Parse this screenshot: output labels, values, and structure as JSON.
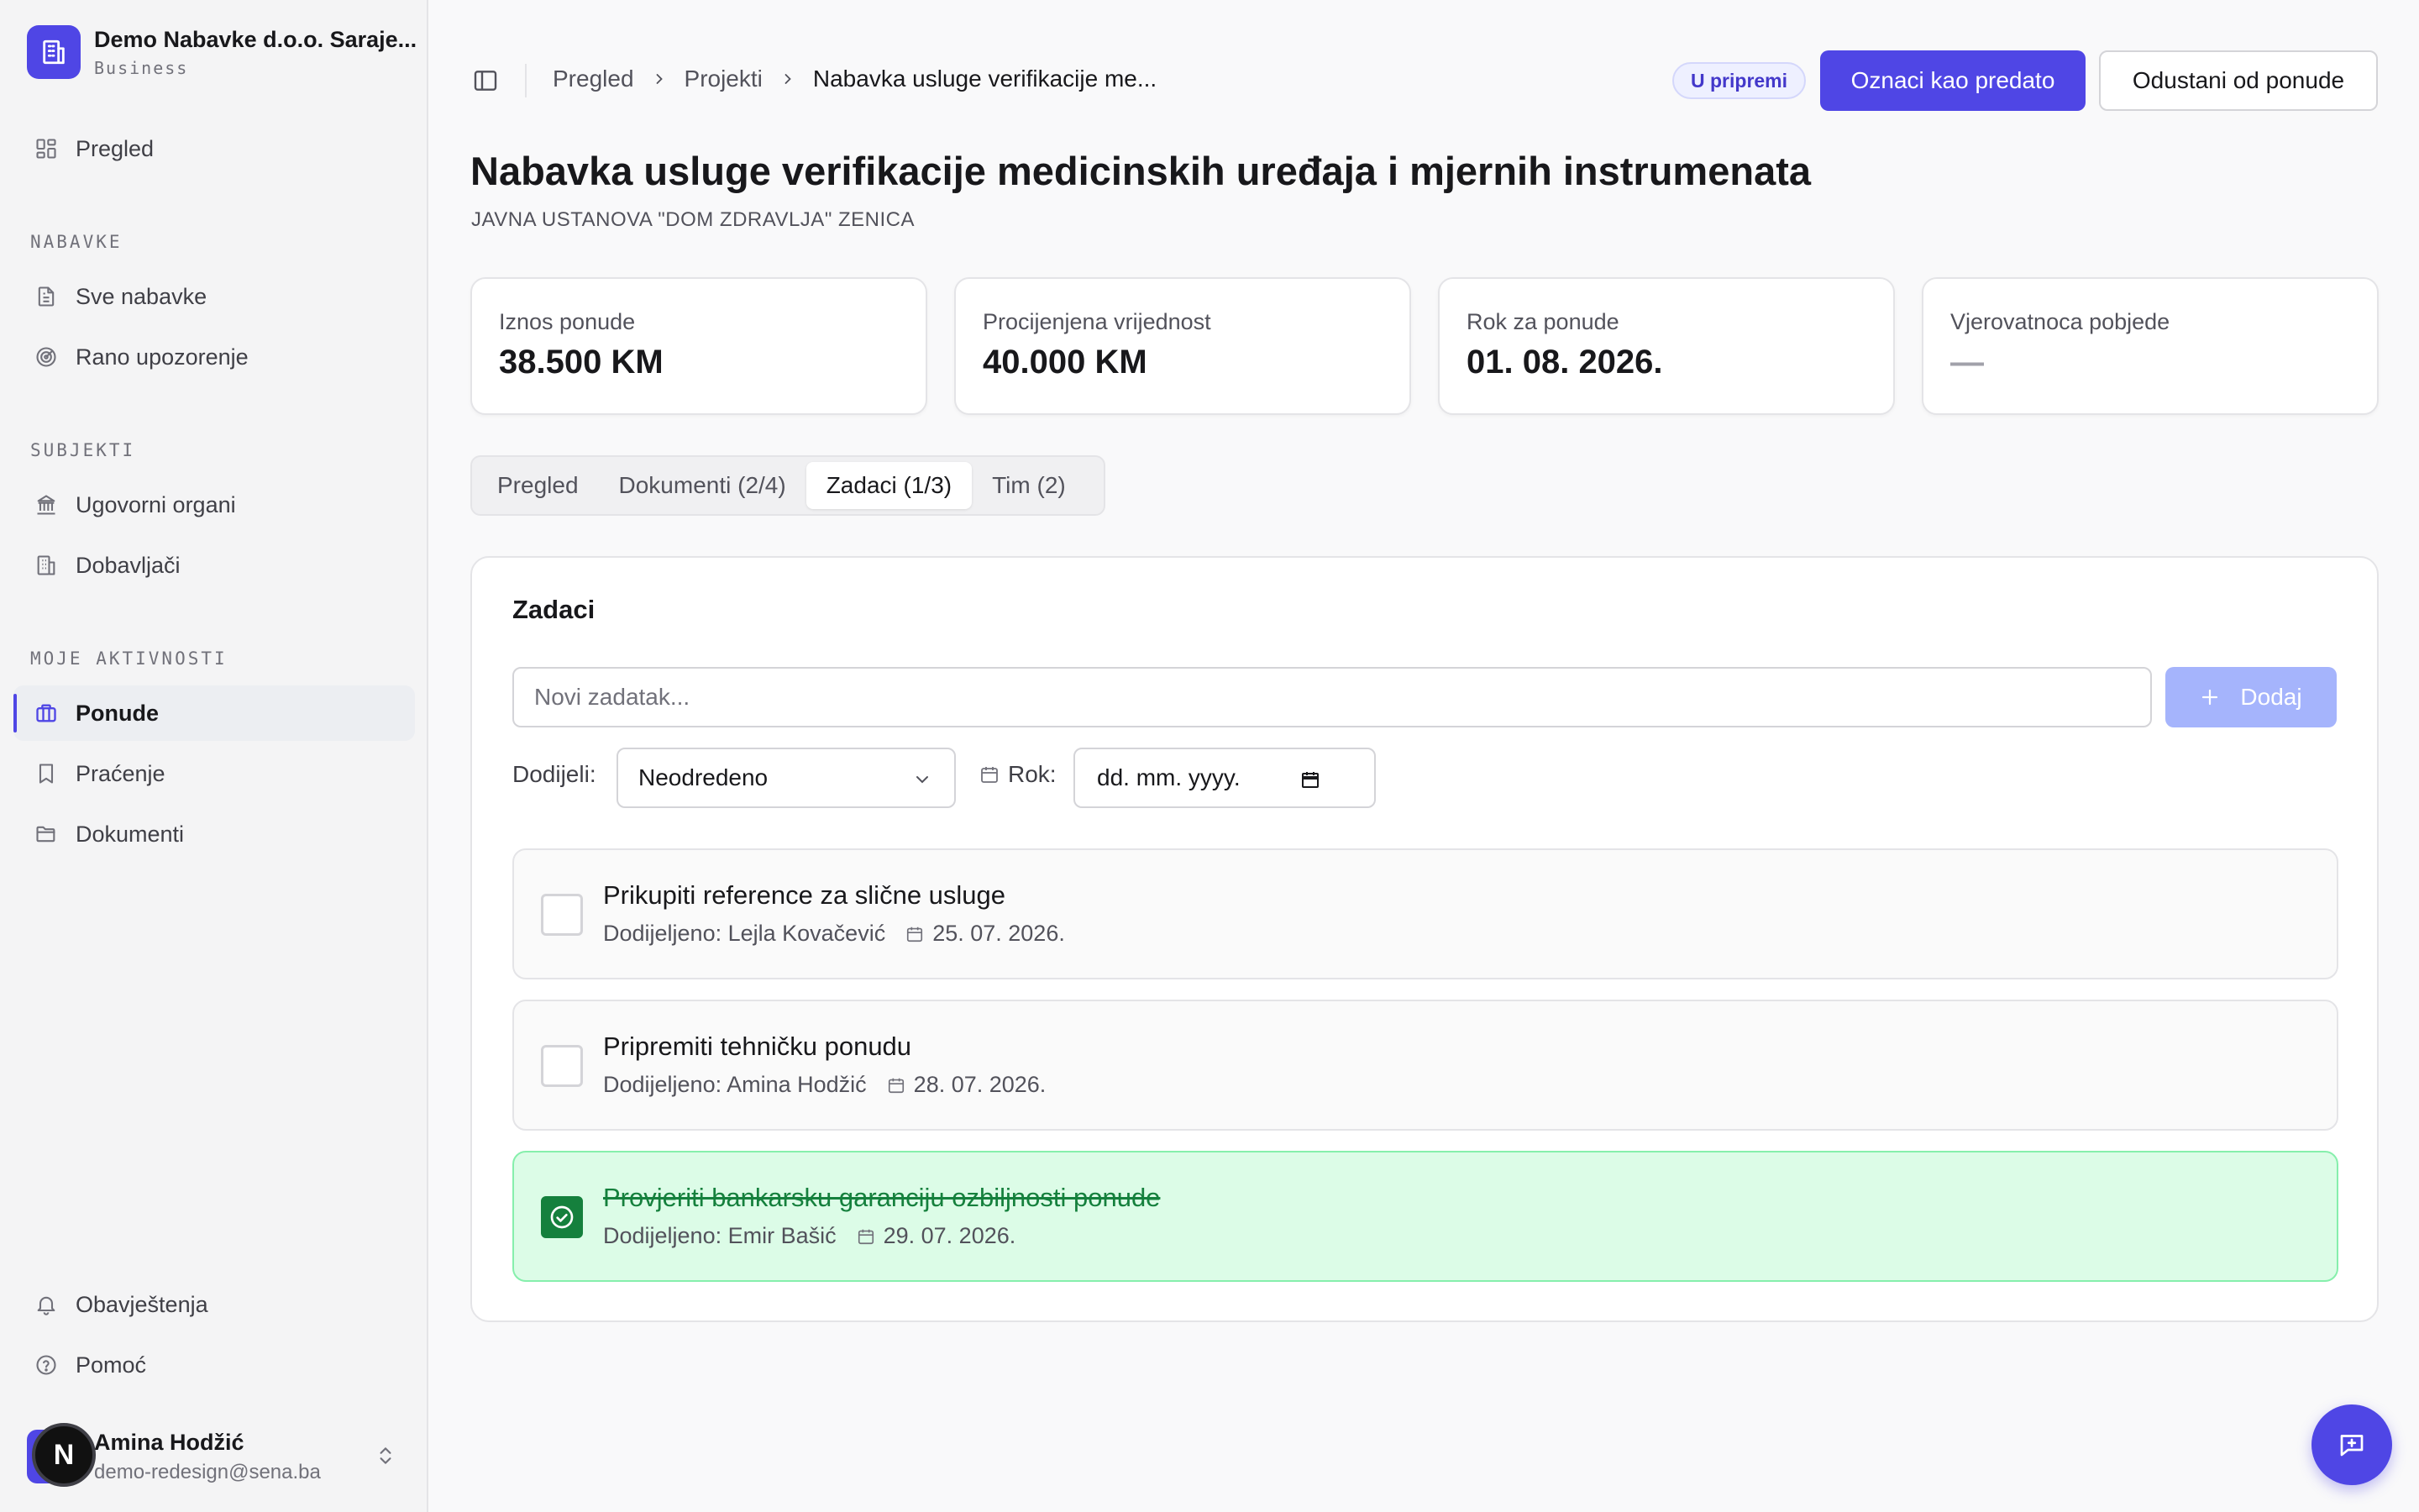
{
  "org": {
    "name": "Demo Nabavke d.o.o. Saraje...",
    "plan": "Business"
  },
  "sidebar": {
    "overview": "Pregled",
    "sections": {
      "nabavke": "NABAVKE",
      "subjekti": "SUBJEKTI",
      "aktivnosti": "MOJE AKTIVNOSTI"
    },
    "items": {
      "sve_nabavke": "Sve nabavke",
      "rano_upozorenje": "Rano upozorenje",
      "ugovorni_organi": "Ugovorni organi",
      "dobavljaci": "Dobavljači",
      "ponude": "Ponude",
      "pracenje": "Praćenje",
      "dokumenti": "Dokumenti",
      "obavjestenja": "Obavještenja",
      "pomoc": "Pomoć"
    },
    "active": "ponude"
  },
  "user": {
    "name": "Amina Hodžić",
    "email": "demo-redesign@sena.ba",
    "badge": "N"
  },
  "breadcrumb": {
    "root": "Pregled",
    "section": "Projekti",
    "current": "Nabavka usluge verifikacije me..."
  },
  "header": {
    "status": "U pripremi",
    "primary_action": "Oznaci kao predato",
    "secondary_action": "Odustani od ponude",
    "title": "Nabavka usluge verifikacije medicinskih uređaja i mjernih instrumenata",
    "subtitle": "JAVNA USTANOVA \"DOM ZDRAVLJA\" ZENICA"
  },
  "stats": [
    {
      "label": "Iznos ponude",
      "value": "38.500 KM"
    },
    {
      "label": "Procijenjena vrijednost",
      "value": "40.000 KM"
    },
    {
      "label": "Rok za ponude",
      "value": "01. 08. 2026."
    },
    {
      "label": "Vjerovatnoca pobjede",
      "value": "—"
    }
  ],
  "tabs": [
    {
      "label": "Pregled",
      "active": false
    },
    {
      "label": "Dokumenti (2/4)",
      "active": false
    },
    {
      "label": "Zadaci (1/3)",
      "active": true
    },
    {
      "label": "Tim (2)",
      "active": false
    }
  ],
  "tasks_panel": {
    "title": "Zadaci",
    "new_placeholder": "Novi zadatak...",
    "new_value": "",
    "add_label": "Dodaj",
    "assign_label": "Dodijeli:",
    "assign_value": "Neodredeno",
    "deadline_label": "Rok:",
    "deadline_value": "dd. mm. yyyy."
  },
  "tasks": [
    {
      "title": "Prikupiti reference za slične usluge",
      "assignee": "Dodijeljeno: Lejla Kovačević",
      "date": "25. 07. 2026.",
      "done": false
    },
    {
      "title": "Pripremiti tehničku ponudu",
      "assignee": "Dodijeljeno: Amina Hodžić",
      "date": "28. 07. 2026.",
      "done": false
    },
    {
      "title": "Provjeriti bankarsku garanciju ozbiljnosti ponude",
      "assignee": "Dodijeljeno: Emir Bašić",
      "date": "29. 07. 2026.",
      "done": true
    }
  ],
  "colors": {
    "accent": "#4f46e5",
    "done_bg": "#dcfce7",
    "done_text": "#15803d"
  },
  "icons": {
    "org": "building-icon",
    "overview": "grid-icon",
    "file": "file-text-icon",
    "radar": "radar-icon",
    "bank": "landmark-icon",
    "suppliers": "building-icon",
    "briefcase": "briefcase-icon",
    "bookmark": "bookmark-icon",
    "folder": "folder-icon",
    "bell": "bell-icon",
    "help": "help-circle-icon",
    "chat": "message-plus-icon"
  }
}
